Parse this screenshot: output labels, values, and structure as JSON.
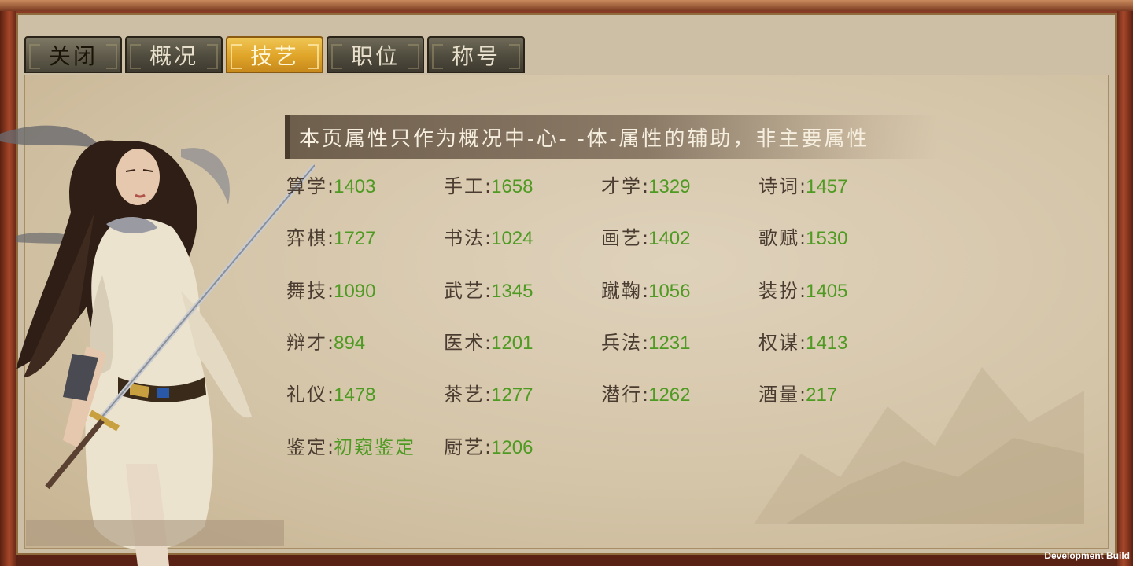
{
  "tabs": [
    {
      "label": "关闭",
      "state": "close"
    },
    {
      "label": "概况",
      "state": "normal"
    },
    {
      "label": "技艺",
      "state": "active"
    },
    {
      "label": "职位",
      "state": "normal"
    },
    {
      "label": "称号",
      "state": "normal"
    }
  ],
  "banner": "本页属性只作为概况中-心- -体-属性的辅助，非主要属性",
  "stats": [
    [
      {
        "k": "算学",
        "v": "1403"
      },
      {
        "k": "手工",
        "v": "1658"
      },
      {
        "k": "才学",
        "v": "1329"
      },
      {
        "k": "诗词",
        "v": "1457"
      }
    ],
    [
      {
        "k": "弈棋",
        "v": "1727"
      },
      {
        "k": "书法",
        "v": "1024"
      },
      {
        "k": "画艺",
        "v": "1402"
      },
      {
        "k": "歌赋",
        "v": "1530"
      }
    ],
    [
      {
        "k": "舞技",
        "v": "1090"
      },
      {
        "k": "武艺",
        "v": "1345"
      },
      {
        "k": "蹴鞠",
        "v": "1056"
      },
      {
        "k": "装扮",
        "v": "1405"
      }
    ],
    [
      {
        "k": "辩才",
        "v": "894"
      },
      {
        "k": "医术",
        "v": "1201"
      },
      {
        "k": "兵法",
        "v": "1231"
      },
      {
        "k": "权谋",
        "v": "1413"
      }
    ],
    [
      {
        "k": "礼仪",
        "v": "1478"
      },
      {
        "k": "茶艺",
        "v": "1277"
      },
      {
        "k": "潜行",
        "v": "1262"
      },
      {
        "k": "酒量",
        "v": "217"
      }
    ],
    [
      {
        "k": "鉴定",
        "v": "初窥鉴定"
      },
      {
        "k": "厨艺",
        "v": "1206"
      }
    ]
  ],
  "separator": ":",
  "dev_build": "Development Build",
  "colors": {
    "value_green": "#4e9a22",
    "label_dark": "#4a3c30",
    "active_tab": "#dfa428"
  }
}
